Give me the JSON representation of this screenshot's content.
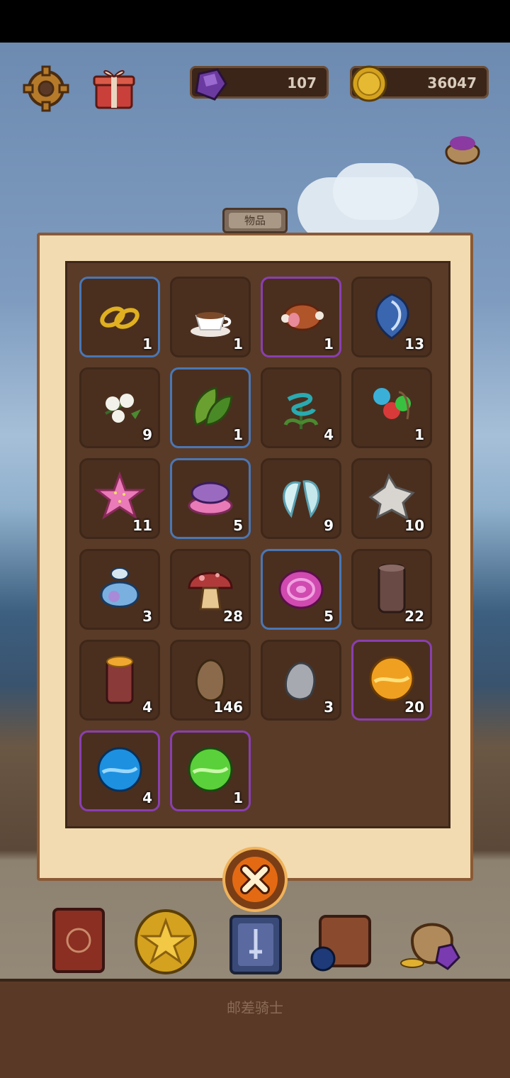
{
  "currencies": {
    "gems": "107",
    "coins": "36047"
  },
  "panel": {
    "tab_title": "物品"
  },
  "inventory": [
    {
      "icon": "gold-rings-icon",
      "count": "1",
      "rarity": "blue"
    },
    {
      "icon": "teacup-icon",
      "count": "1",
      "rarity": "none"
    },
    {
      "icon": "meat-icon",
      "count": "1",
      "rarity": "purple"
    },
    {
      "icon": "blue-leaf-icon",
      "count": "13",
      "rarity": "none"
    },
    {
      "icon": "cotton-icon",
      "count": "9",
      "rarity": "none"
    },
    {
      "icon": "green-leaves-icon",
      "count": "1",
      "rarity": "blue"
    },
    {
      "icon": "spiral-flower-icon",
      "count": "4",
      "rarity": "none"
    },
    {
      "icon": "berries-icon",
      "count": "1",
      "rarity": "none"
    },
    {
      "icon": "starfish-icon",
      "count": "11",
      "rarity": "none"
    },
    {
      "icon": "pink-clam-icon",
      "count": "5",
      "rarity": "blue"
    },
    {
      "icon": "wings-icon",
      "count": "9",
      "rarity": "none"
    },
    {
      "icon": "fur-pelt-icon",
      "count": "10",
      "rarity": "none"
    },
    {
      "icon": "glass-sack-icon",
      "count": "3",
      "rarity": "none"
    },
    {
      "icon": "mushroom-icon",
      "count": "28",
      "rarity": "none"
    },
    {
      "icon": "pink-crystal-icon",
      "count": "5",
      "rarity": "blue"
    },
    {
      "icon": "glass-jar-icon",
      "count": "22",
      "rarity": "none"
    },
    {
      "icon": "wood-log-icon",
      "count": "4",
      "rarity": "none"
    },
    {
      "icon": "brown-stone-icon",
      "count": "146",
      "rarity": "none"
    },
    {
      "icon": "grey-stone-icon",
      "count": "3",
      "rarity": "none"
    },
    {
      "icon": "orange-orb-icon",
      "count": "20",
      "rarity": "purple"
    },
    {
      "icon": "blue-orb-icon",
      "count": "4",
      "rarity": "purple"
    },
    {
      "icon": "green-orb-icon",
      "count": "1",
      "rarity": "purple"
    }
  ],
  "dock": {
    "label": "邮差骑士"
  }
}
